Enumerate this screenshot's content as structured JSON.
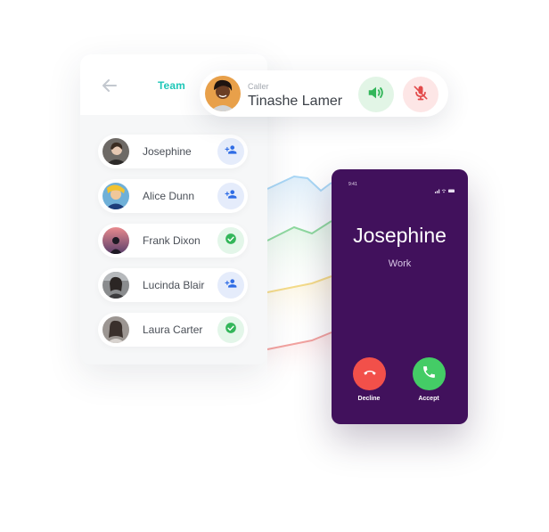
{
  "team": {
    "title": "Team",
    "members": [
      {
        "name": "Josephine",
        "action": "add",
        "action_icon": "add-user-icon"
      },
      {
        "name": "Alice Dunn",
        "action": "add",
        "action_icon": "add-user-icon"
      },
      {
        "name": "Frank Dixon",
        "action": "added",
        "action_icon": "check-circle-icon"
      },
      {
        "name": "Lucinda Blair",
        "action": "add",
        "action_icon": "add-user-icon"
      },
      {
        "name": "Laura Carter",
        "action": "added",
        "action_icon": "check-circle-icon"
      }
    ]
  },
  "caller": {
    "label": "Caller",
    "name": "Tinashe Lamer",
    "speaker_icon": "speaker-icon",
    "mute_icon": "mic-off-icon"
  },
  "incoming_call": {
    "status_time": "9:41",
    "name": "Josephine",
    "subtitle": "Work",
    "decline_label": "Decline",
    "accept_label": "Accept"
  },
  "colors": {
    "accent_teal": "#1fc7b8",
    "phone_bg": "#41115c",
    "decline": "#f2504a",
    "accept": "#44cc66",
    "add_blue": "#2f6ce5",
    "check_green": "#33b65a",
    "mute_red": "#e24a4a"
  }
}
